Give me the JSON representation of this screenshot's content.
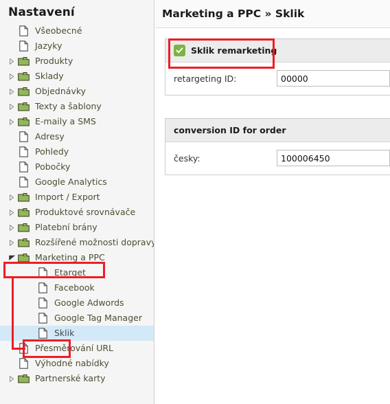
{
  "sidebar": {
    "title": "Nastavení",
    "items": [
      {
        "label": "Všeobecné",
        "icon": "file-icon",
        "level": 1,
        "expandable": false,
        "selected": false
      },
      {
        "label": "Jazyky",
        "icon": "file-icon",
        "level": 1,
        "expandable": false,
        "selected": false
      },
      {
        "label": "Produkty",
        "icon": "folder-icon",
        "level": 0,
        "expandable": true,
        "selected": false
      },
      {
        "label": "Sklady",
        "icon": "folder-icon",
        "level": 0,
        "expandable": true,
        "selected": false
      },
      {
        "label": "Objednávky",
        "icon": "folder-icon",
        "level": 0,
        "expandable": true,
        "selected": false
      },
      {
        "label": "Texty a šablony",
        "icon": "folder-icon",
        "level": 0,
        "expandable": true,
        "selected": false
      },
      {
        "label": "E-maily a SMS",
        "icon": "folder-icon",
        "level": 0,
        "expandable": true,
        "selected": false
      },
      {
        "label": "Adresy",
        "icon": "file-icon",
        "level": 1,
        "expandable": false,
        "selected": false
      },
      {
        "label": "Pohledy",
        "icon": "file-icon",
        "level": 1,
        "expandable": false,
        "selected": false
      },
      {
        "label": "Pobočky",
        "icon": "file-icon",
        "level": 1,
        "expandable": false,
        "selected": false
      },
      {
        "label": "Google Analytics",
        "icon": "file-icon",
        "level": 1,
        "expandable": false,
        "selected": false
      },
      {
        "label": "Import / Export",
        "icon": "folder-icon",
        "level": 0,
        "expandable": true,
        "selected": false
      },
      {
        "label": "Produktové srovnávače",
        "icon": "folder-icon",
        "level": 0,
        "expandable": true,
        "selected": false
      },
      {
        "label": "Platební brány",
        "icon": "folder-icon",
        "level": 0,
        "expandable": true,
        "selected": false
      },
      {
        "label": "Rozšířené možnosti dopravy",
        "icon": "folder-icon",
        "level": 0,
        "expandable": true,
        "selected": false
      },
      {
        "label": "Marketing a PPC",
        "icon": "folder-icon",
        "level": 0,
        "expandable": true,
        "expanded": true,
        "selected": false
      },
      {
        "label": "Etarget",
        "icon": "file-icon",
        "level": 2,
        "expandable": false,
        "selected": false
      },
      {
        "label": "Facebook",
        "icon": "file-icon",
        "level": 2,
        "expandable": false,
        "selected": false
      },
      {
        "label": "Google Adwords",
        "icon": "file-icon",
        "level": 2,
        "expandable": false,
        "selected": false
      },
      {
        "label": "Google Tag Manager",
        "icon": "file-icon",
        "level": 2,
        "expandable": false,
        "selected": false
      },
      {
        "label": "Sklik",
        "icon": "file-icon",
        "level": 2,
        "expandable": false,
        "selected": true
      },
      {
        "label": "Přesměrování URL",
        "icon": "file-icon",
        "level": 1,
        "expandable": false,
        "selected": false
      },
      {
        "label": "Výhodné nabídky",
        "icon": "file-icon",
        "level": 1,
        "expandable": false,
        "selected": false
      },
      {
        "label": "Partnerské karty",
        "icon": "folder-icon",
        "level": 0,
        "expandable": true,
        "selected": false
      }
    ]
  },
  "header": {
    "title": "Marketing a PPC » Sklik"
  },
  "panels": {
    "remarketing": {
      "heading": "Sklik remarketing",
      "checkbox_checked": true,
      "field_label": "retargeting ID:",
      "field_value": "00000",
      "field_placeholder": ""
    },
    "conversion": {
      "heading": "conversion ID for order",
      "field_label": "česky:",
      "field_value": "100006450",
      "field_placeholder": ""
    }
  },
  "annotations": {
    "color": "#ee1c25",
    "boxes": [
      {
        "name": "marketing-a-ppc-highlight"
      },
      {
        "name": "sklik-highlight"
      },
      {
        "name": "sklik-remarketing-highlight"
      }
    ]
  },
  "colors": {
    "accent_green": "#7cb342",
    "folder_green": "#8fb85c",
    "selection_blue": "#d3e9f7",
    "annotation_red": "#ee1c25",
    "sidebar_bg": "#f5f5f5"
  }
}
